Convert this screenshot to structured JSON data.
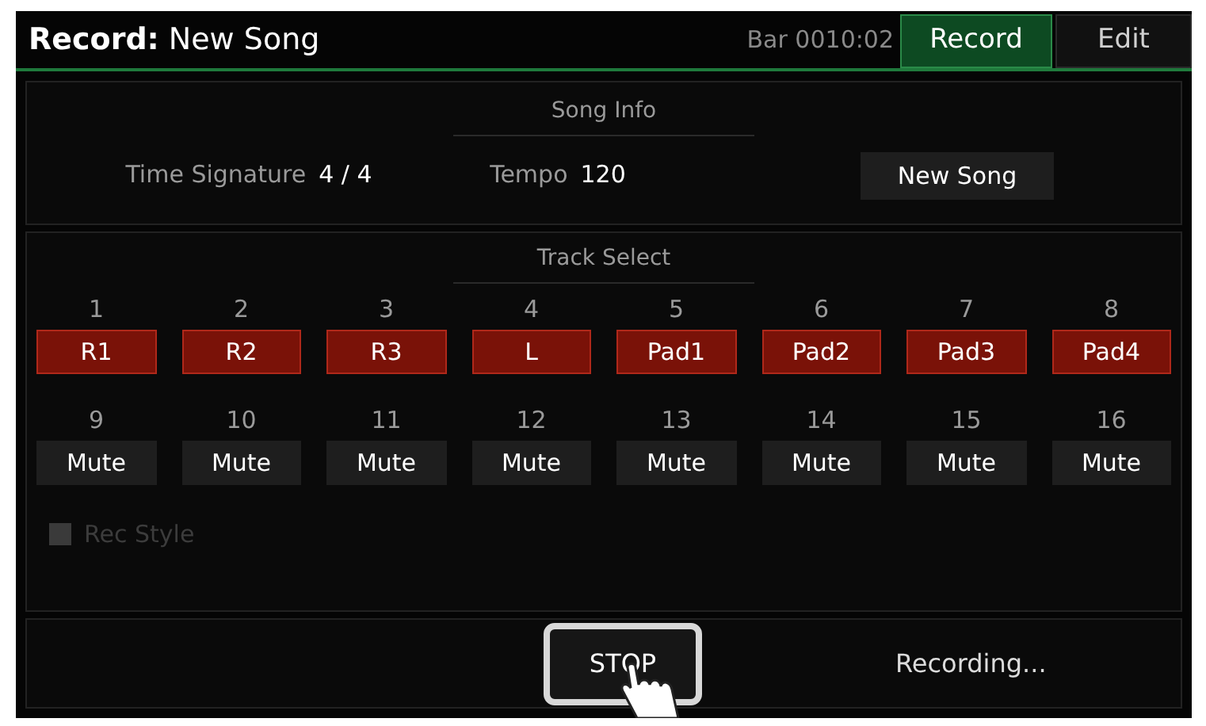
{
  "title": {
    "bold": "Record:",
    "text": "New Song"
  },
  "bar": "Bar 0010:02",
  "tabs": [
    {
      "label": "Record",
      "selected": true
    },
    {
      "label": "Edit",
      "selected": false
    }
  ],
  "song_info": {
    "heading": "Song Info",
    "time_signature_label": "Time Signature",
    "time_signature": "4 / 4",
    "tempo_label": "Tempo",
    "tempo": "120",
    "new_song_button": "New Song"
  },
  "track_select": {
    "heading": "Track Select",
    "tracks": [
      {
        "number": "1",
        "label": "R1",
        "armed": true
      },
      {
        "number": "2",
        "label": "R2",
        "armed": true
      },
      {
        "number": "3",
        "label": "R3",
        "armed": true
      },
      {
        "number": "4",
        "label": "L",
        "armed": true
      },
      {
        "number": "5",
        "label": "Pad1",
        "armed": true
      },
      {
        "number": "6",
        "label": "Pad2",
        "armed": true
      },
      {
        "number": "7",
        "label": "Pad3",
        "armed": true
      },
      {
        "number": "8",
        "label": "Pad4",
        "armed": true
      },
      {
        "number": "9",
        "label": "Mute",
        "armed": false
      },
      {
        "number": "10",
        "label": "Mute",
        "armed": false
      },
      {
        "number": "11",
        "label": "Mute",
        "armed": false
      },
      {
        "number": "12",
        "label": "Mute",
        "armed": false
      },
      {
        "number": "13",
        "label": "Mute",
        "armed": false
      },
      {
        "number": "14",
        "label": "Mute",
        "armed": false
      },
      {
        "number": "15",
        "label": "Mute",
        "armed": false
      },
      {
        "number": "16",
        "label": "Mute",
        "armed": false
      }
    ],
    "rec_style": {
      "label": "Rec Style",
      "checked": false,
      "disabled": true
    }
  },
  "stop_button": "STOP",
  "status": "Recording..."
}
